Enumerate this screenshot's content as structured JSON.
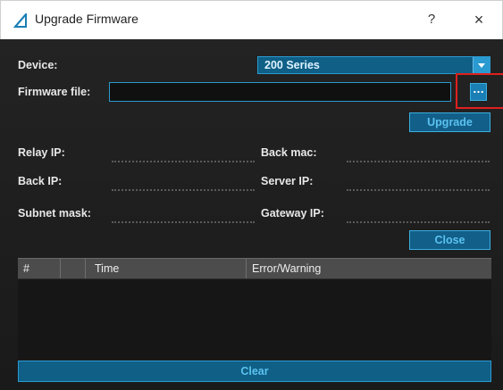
{
  "window": {
    "title": "Upgrade Firmware",
    "help_label": "?",
    "close_label": "×"
  },
  "form": {
    "device_label": "Device:",
    "device_value": "200 Series",
    "firmware_label": "Firmware file:",
    "firmware_value": "",
    "browse_label": "...",
    "upgrade_label": "Upgrade"
  },
  "info": {
    "relay_ip_label": "Relay IP:",
    "back_mac_label": "Back mac:",
    "back_ip_label": "Back IP:",
    "server_ip_label": "Server IP:",
    "subnet_mask_label": "Subnet mask:",
    "gateway_ip_label": "Gateway IP:"
  },
  "actions": {
    "close_label": "Close",
    "clear_label": "Clear"
  },
  "log": {
    "columns": [
      "#",
      "",
      "Time",
      "Error/Warning"
    ],
    "rows": []
  },
  "colors": {
    "accent": "#2a9ad0",
    "button_text": "#5bc2ef",
    "highlight": "#e0201e",
    "background": "#1c1c1c"
  }
}
